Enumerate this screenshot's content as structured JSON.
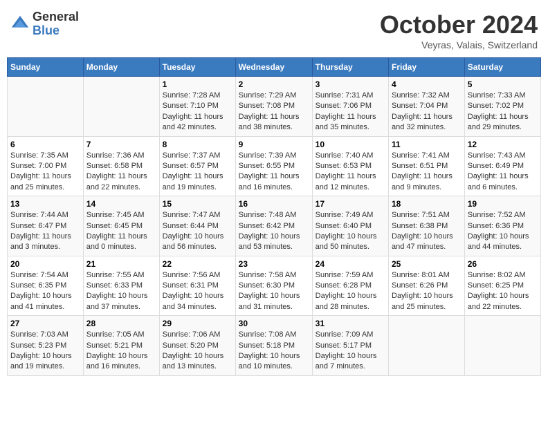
{
  "header": {
    "logo_line1": "General",
    "logo_line2": "Blue",
    "month": "October 2024",
    "location": "Veyras, Valais, Switzerland"
  },
  "days_of_week": [
    "Sunday",
    "Monday",
    "Tuesday",
    "Wednesday",
    "Thursday",
    "Friday",
    "Saturday"
  ],
  "weeks": [
    [
      {
        "day": "",
        "content": ""
      },
      {
        "day": "",
        "content": ""
      },
      {
        "day": "1",
        "content": "Sunrise: 7:28 AM\nSunset: 7:10 PM\nDaylight: 11 hours and 42 minutes."
      },
      {
        "day": "2",
        "content": "Sunrise: 7:29 AM\nSunset: 7:08 PM\nDaylight: 11 hours and 38 minutes."
      },
      {
        "day": "3",
        "content": "Sunrise: 7:31 AM\nSunset: 7:06 PM\nDaylight: 11 hours and 35 minutes."
      },
      {
        "day": "4",
        "content": "Sunrise: 7:32 AM\nSunset: 7:04 PM\nDaylight: 11 hours and 32 minutes."
      },
      {
        "day": "5",
        "content": "Sunrise: 7:33 AM\nSunset: 7:02 PM\nDaylight: 11 hours and 29 minutes."
      }
    ],
    [
      {
        "day": "6",
        "content": "Sunrise: 7:35 AM\nSunset: 7:00 PM\nDaylight: 11 hours and 25 minutes."
      },
      {
        "day": "7",
        "content": "Sunrise: 7:36 AM\nSunset: 6:58 PM\nDaylight: 11 hours and 22 minutes."
      },
      {
        "day": "8",
        "content": "Sunrise: 7:37 AM\nSunset: 6:57 PM\nDaylight: 11 hours and 19 minutes."
      },
      {
        "day": "9",
        "content": "Sunrise: 7:39 AM\nSunset: 6:55 PM\nDaylight: 11 hours and 16 minutes."
      },
      {
        "day": "10",
        "content": "Sunrise: 7:40 AM\nSunset: 6:53 PM\nDaylight: 11 hours and 12 minutes."
      },
      {
        "day": "11",
        "content": "Sunrise: 7:41 AM\nSunset: 6:51 PM\nDaylight: 11 hours and 9 minutes."
      },
      {
        "day": "12",
        "content": "Sunrise: 7:43 AM\nSunset: 6:49 PM\nDaylight: 11 hours and 6 minutes."
      }
    ],
    [
      {
        "day": "13",
        "content": "Sunrise: 7:44 AM\nSunset: 6:47 PM\nDaylight: 11 hours and 3 minutes."
      },
      {
        "day": "14",
        "content": "Sunrise: 7:45 AM\nSunset: 6:45 PM\nDaylight: 11 hours and 0 minutes."
      },
      {
        "day": "15",
        "content": "Sunrise: 7:47 AM\nSunset: 6:44 PM\nDaylight: 10 hours and 56 minutes."
      },
      {
        "day": "16",
        "content": "Sunrise: 7:48 AM\nSunset: 6:42 PM\nDaylight: 10 hours and 53 minutes."
      },
      {
        "day": "17",
        "content": "Sunrise: 7:49 AM\nSunset: 6:40 PM\nDaylight: 10 hours and 50 minutes."
      },
      {
        "day": "18",
        "content": "Sunrise: 7:51 AM\nSunset: 6:38 PM\nDaylight: 10 hours and 47 minutes."
      },
      {
        "day": "19",
        "content": "Sunrise: 7:52 AM\nSunset: 6:36 PM\nDaylight: 10 hours and 44 minutes."
      }
    ],
    [
      {
        "day": "20",
        "content": "Sunrise: 7:54 AM\nSunset: 6:35 PM\nDaylight: 10 hours and 41 minutes."
      },
      {
        "day": "21",
        "content": "Sunrise: 7:55 AM\nSunset: 6:33 PM\nDaylight: 10 hours and 37 minutes."
      },
      {
        "day": "22",
        "content": "Sunrise: 7:56 AM\nSunset: 6:31 PM\nDaylight: 10 hours and 34 minutes."
      },
      {
        "day": "23",
        "content": "Sunrise: 7:58 AM\nSunset: 6:30 PM\nDaylight: 10 hours and 31 minutes."
      },
      {
        "day": "24",
        "content": "Sunrise: 7:59 AM\nSunset: 6:28 PM\nDaylight: 10 hours and 28 minutes."
      },
      {
        "day": "25",
        "content": "Sunrise: 8:01 AM\nSunset: 6:26 PM\nDaylight: 10 hours and 25 minutes."
      },
      {
        "day": "26",
        "content": "Sunrise: 8:02 AM\nSunset: 6:25 PM\nDaylight: 10 hours and 22 minutes."
      }
    ],
    [
      {
        "day": "27",
        "content": "Sunrise: 7:03 AM\nSunset: 5:23 PM\nDaylight: 10 hours and 19 minutes."
      },
      {
        "day": "28",
        "content": "Sunrise: 7:05 AM\nSunset: 5:21 PM\nDaylight: 10 hours and 16 minutes."
      },
      {
        "day": "29",
        "content": "Sunrise: 7:06 AM\nSunset: 5:20 PM\nDaylight: 10 hours and 13 minutes."
      },
      {
        "day": "30",
        "content": "Sunrise: 7:08 AM\nSunset: 5:18 PM\nDaylight: 10 hours and 10 minutes."
      },
      {
        "day": "31",
        "content": "Sunrise: 7:09 AM\nSunset: 5:17 PM\nDaylight: 10 hours and 7 minutes."
      },
      {
        "day": "",
        "content": ""
      },
      {
        "day": "",
        "content": ""
      }
    ]
  ]
}
